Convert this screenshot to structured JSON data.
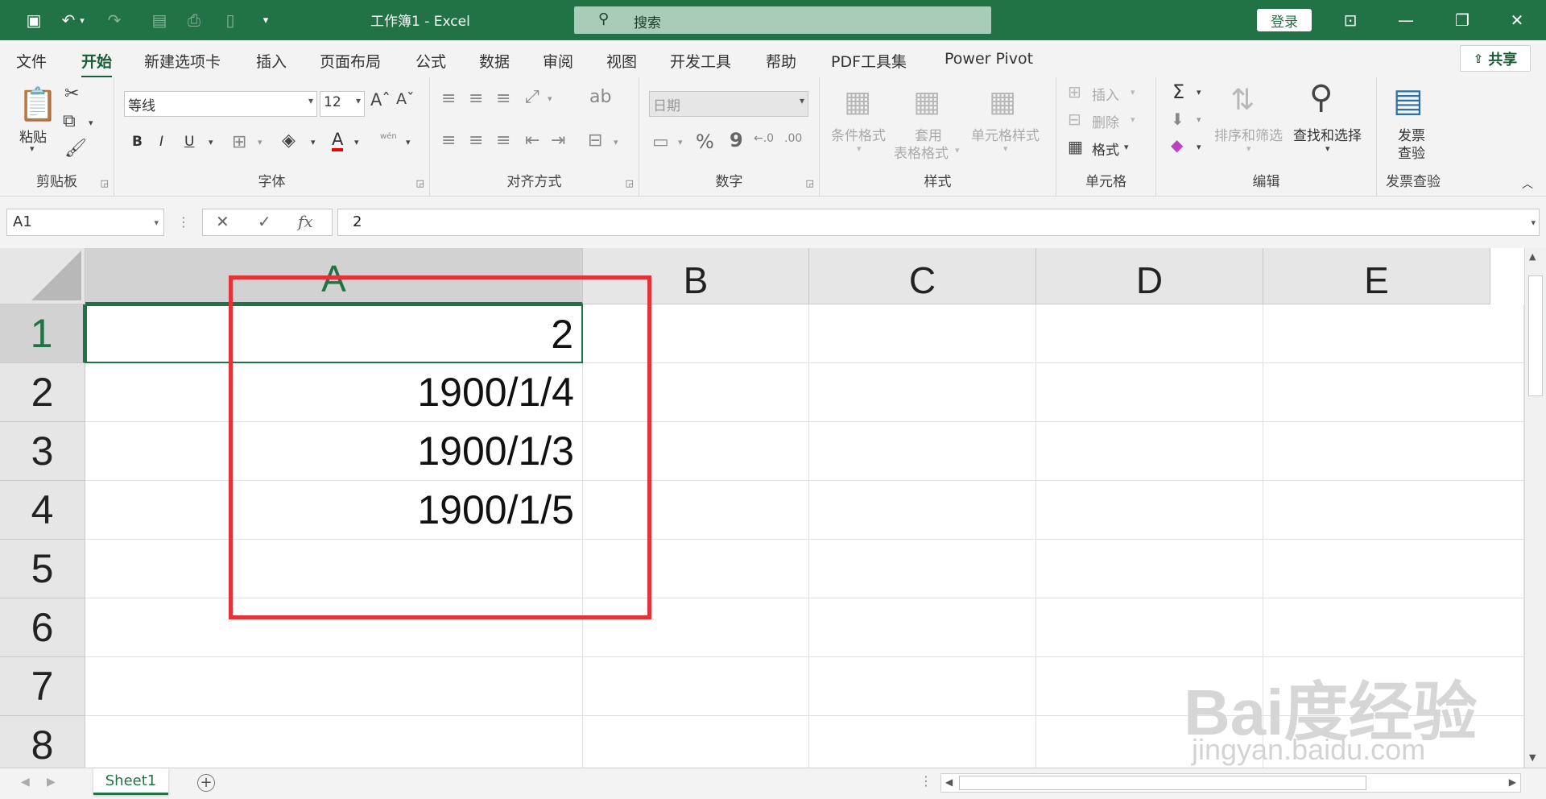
{
  "app": {
    "title": "工作簿1  -  Excel"
  },
  "search": {
    "label": "搜索"
  },
  "account": {
    "login": "登录"
  },
  "tabs": [
    "文件",
    "开始",
    "新建选项卡",
    "插入",
    "页面布局",
    "公式",
    "数据",
    "审阅",
    "视图",
    "开发工具",
    "帮助",
    "PDF工具集",
    "Power Pivot"
  ],
  "active_tab": "开始",
  "share": {
    "label": "共享"
  },
  "ribbon": {
    "clipboard": {
      "paste": "粘贴",
      "group": "剪贴板"
    },
    "font": {
      "name": "等线",
      "size": "12",
      "bold": "B",
      "italic": "I",
      "underline": "U",
      "font_color": "A",
      "phonetic": "wén",
      "group": "字体"
    },
    "alignment": {
      "group": "对齐方式"
    },
    "number": {
      "format": "日期",
      "percent": "%",
      "comma": "9",
      "group": "数字"
    },
    "styles": {
      "conditional": "条件格式",
      "table_line1": "套用",
      "table_line2": "表格格式",
      "cell_styles": "单元格样式",
      "group": "样式"
    },
    "cells": {
      "insert": "插入",
      "delete": "删除",
      "format": "格式",
      "group": "单元格"
    },
    "editing": {
      "sum": "Σ",
      "sort_filter": "排序和筛选",
      "find_select": "查找和选择",
      "group": "编辑"
    },
    "invoice": {
      "check_line1": "发票",
      "check_line2": "查验",
      "group": "发票查验"
    }
  },
  "formula_bar": {
    "name_box": "A1",
    "fx": "fx",
    "content": "2"
  },
  "grid": {
    "columns": [
      "A",
      "B",
      "C",
      "D",
      "E"
    ],
    "rows": [
      "1",
      "2",
      "3",
      "4",
      "5",
      "6",
      "7",
      "8"
    ],
    "cells": {
      "A1": "2",
      "A2": "1900/1/4",
      "A3": "1900/1/3",
      "A4": "1900/1/5"
    },
    "active_cell": "A1"
  },
  "sheets": {
    "tab": "Sheet1",
    "add": "+"
  },
  "watermark": {
    "brand": "Bai度经验",
    "url": "jingyan.baidu.com"
  },
  "colors": {
    "excel_green": "#217346",
    "highlight_red": "#e53238"
  }
}
